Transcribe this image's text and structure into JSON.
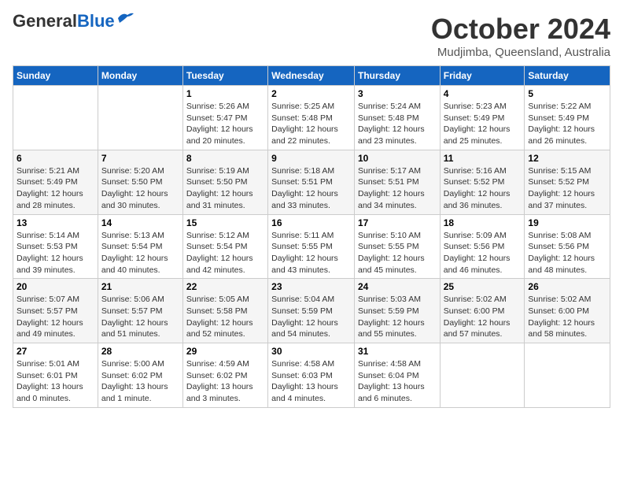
{
  "header": {
    "logo_general": "General",
    "logo_blue": "Blue",
    "month_year": "October 2024",
    "location": "Mudjimba, Queensland, Australia"
  },
  "weekdays": [
    "Sunday",
    "Monday",
    "Tuesday",
    "Wednesday",
    "Thursday",
    "Friday",
    "Saturday"
  ],
  "weeks": [
    [
      {
        "day": "",
        "info": ""
      },
      {
        "day": "",
        "info": ""
      },
      {
        "day": "1",
        "info": "Sunrise: 5:26 AM\nSunset: 5:47 PM\nDaylight: 12 hours\nand 20 minutes."
      },
      {
        "day": "2",
        "info": "Sunrise: 5:25 AM\nSunset: 5:48 PM\nDaylight: 12 hours\nand 22 minutes."
      },
      {
        "day": "3",
        "info": "Sunrise: 5:24 AM\nSunset: 5:48 PM\nDaylight: 12 hours\nand 23 minutes."
      },
      {
        "day": "4",
        "info": "Sunrise: 5:23 AM\nSunset: 5:49 PM\nDaylight: 12 hours\nand 25 minutes."
      },
      {
        "day": "5",
        "info": "Sunrise: 5:22 AM\nSunset: 5:49 PM\nDaylight: 12 hours\nand 26 minutes."
      }
    ],
    [
      {
        "day": "6",
        "info": "Sunrise: 5:21 AM\nSunset: 5:49 PM\nDaylight: 12 hours\nand 28 minutes."
      },
      {
        "day": "7",
        "info": "Sunrise: 5:20 AM\nSunset: 5:50 PM\nDaylight: 12 hours\nand 30 minutes."
      },
      {
        "day": "8",
        "info": "Sunrise: 5:19 AM\nSunset: 5:50 PM\nDaylight: 12 hours\nand 31 minutes."
      },
      {
        "day": "9",
        "info": "Sunrise: 5:18 AM\nSunset: 5:51 PM\nDaylight: 12 hours\nand 33 minutes."
      },
      {
        "day": "10",
        "info": "Sunrise: 5:17 AM\nSunset: 5:51 PM\nDaylight: 12 hours\nand 34 minutes."
      },
      {
        "day": "11",
        "info": "Sunrise: 5:16 AM\nSunset: 5:52 PM\nDaylight: 12 hours\nand 36 minutes."
      },
      {
        "day": "12",
        "info": "Sunrise: 5:15 AM\nSunset: 5:52 PM\nDaylight: 12 hours\nand 37 minutes."
      }
    ],
    [
      {
        "day": "13",
        "info": "Sunrise: 5:14 AM\nSunset: 5:53 PM\nDaylight: 12 hours\nand 39 minutes."
      },
      {
        "day": "14",
        "info": "Sunrise: 5:13 AM\nSunset: 5:54 PM\nDaylight: 12 hours\nand 40 minutes."
      },
      {
        "day": "15",
        "info": "Sunrise: 5:12 AM\nSunset: 5:54 PM\nDaylight: 12 hours\nand 42 minutes."
      },
      {
        "day": "16",
        "info": "Sunrise: 5:11 AM\nSunset: 5:55 PM\nDaylight: 12 hours\nand 43 minutes."
      },
      {
        "day": "17",
        "info": "Sunrise: 5:10 AM\nSunset: 5:55 PM\nDaylight: 12 hours\nand 45 minutes."
      },
      {
        "day": "18",
        "info": "Sunrise: 5:09 AM\nSunset: 5:56 PM\nDaylight: 12 hours\nand 46 minutes."
      },
      {
        "day": "19",
        "info": "Sunrise: 5:08 AM\nSunset: 5:56 PM\nDaylight: 12 hours\nand 48 minutes."
      }
    ],
    [
      {
        "day": "20",
        "info": "Sunrise: 5:07 AM\nSunset: 5:57 PM\nDaylight: 12 hours\nand 49 minutes."
      },
      {
        "day": "21",
        "info": "Sunrise: 5:06 AM\nSunset: 5:57 PM\nDaylight: 12 hours\nand 51 minutes."
      },
      {
        "day": "22",
        "info": "Sunrise: 5:05 AM\nSunset: 5:58 PM\nDaylight: 12 hours\nand 52 minutes."
      },
      {
        "day": "23",
        "info": "Sunrise: 5:04 AM\nSunset: 5:59 PM\nDaylight: 12 hours\nand 54 minutes."
      },
      {
        "day": "24",
        "info": "Sunrise: 5:03 AM\nSunset: 5:59 PM\nDaylight: 12 hours\nand 55 minutes."
      },
      {
        "day": "25",
        "info": "Sunrise: 5:02 AM\nSunset: 6:00 PM\nDaylight: 12 hours\nand 57 minutes."
      },
      {
        "day": "26",
        "info": "Sunrise: 5:02 AM\nSunset: 6:00 PM\nDaylight: 12 hours\nand 58 minutes."
      }
    ],
    [
      {
        "day": "27",
        "info": "Sunrise: 5:01 AM\nSunset: 6:01 PM\nDaylight: 13 hours\nand 0 minutes."
      },
      {
        "day": "28",
        "info": "Sunrise: 5:00 AM\nSunset: 6:02 PM\nDaylight: 13 hours\nand 1 minute."
      },
      {
        "day": "29",
        "info": "Sunrise: 4:59 AM\nSunset: 6:02 PM\nDaylight: 13 hours\nand 3 minutes."
      },
      {
        "day": "30",
        "info": "Sunrise: 4:58 AM\nSunset: 6:03 PM\nDaylight: 13 hours\nand 4 minutes."
      },
      {
        "day": "31",
        "info": "Sunrise: 4:58 AM\nSunset: 6:04 PM\nDaylight: 13 hours\nand 6 minutes."
      },
      {
        "day": "",
        "info": ""
      },
      {
        "day": "",
        "info": ""
      }
    ]
  ]
}
